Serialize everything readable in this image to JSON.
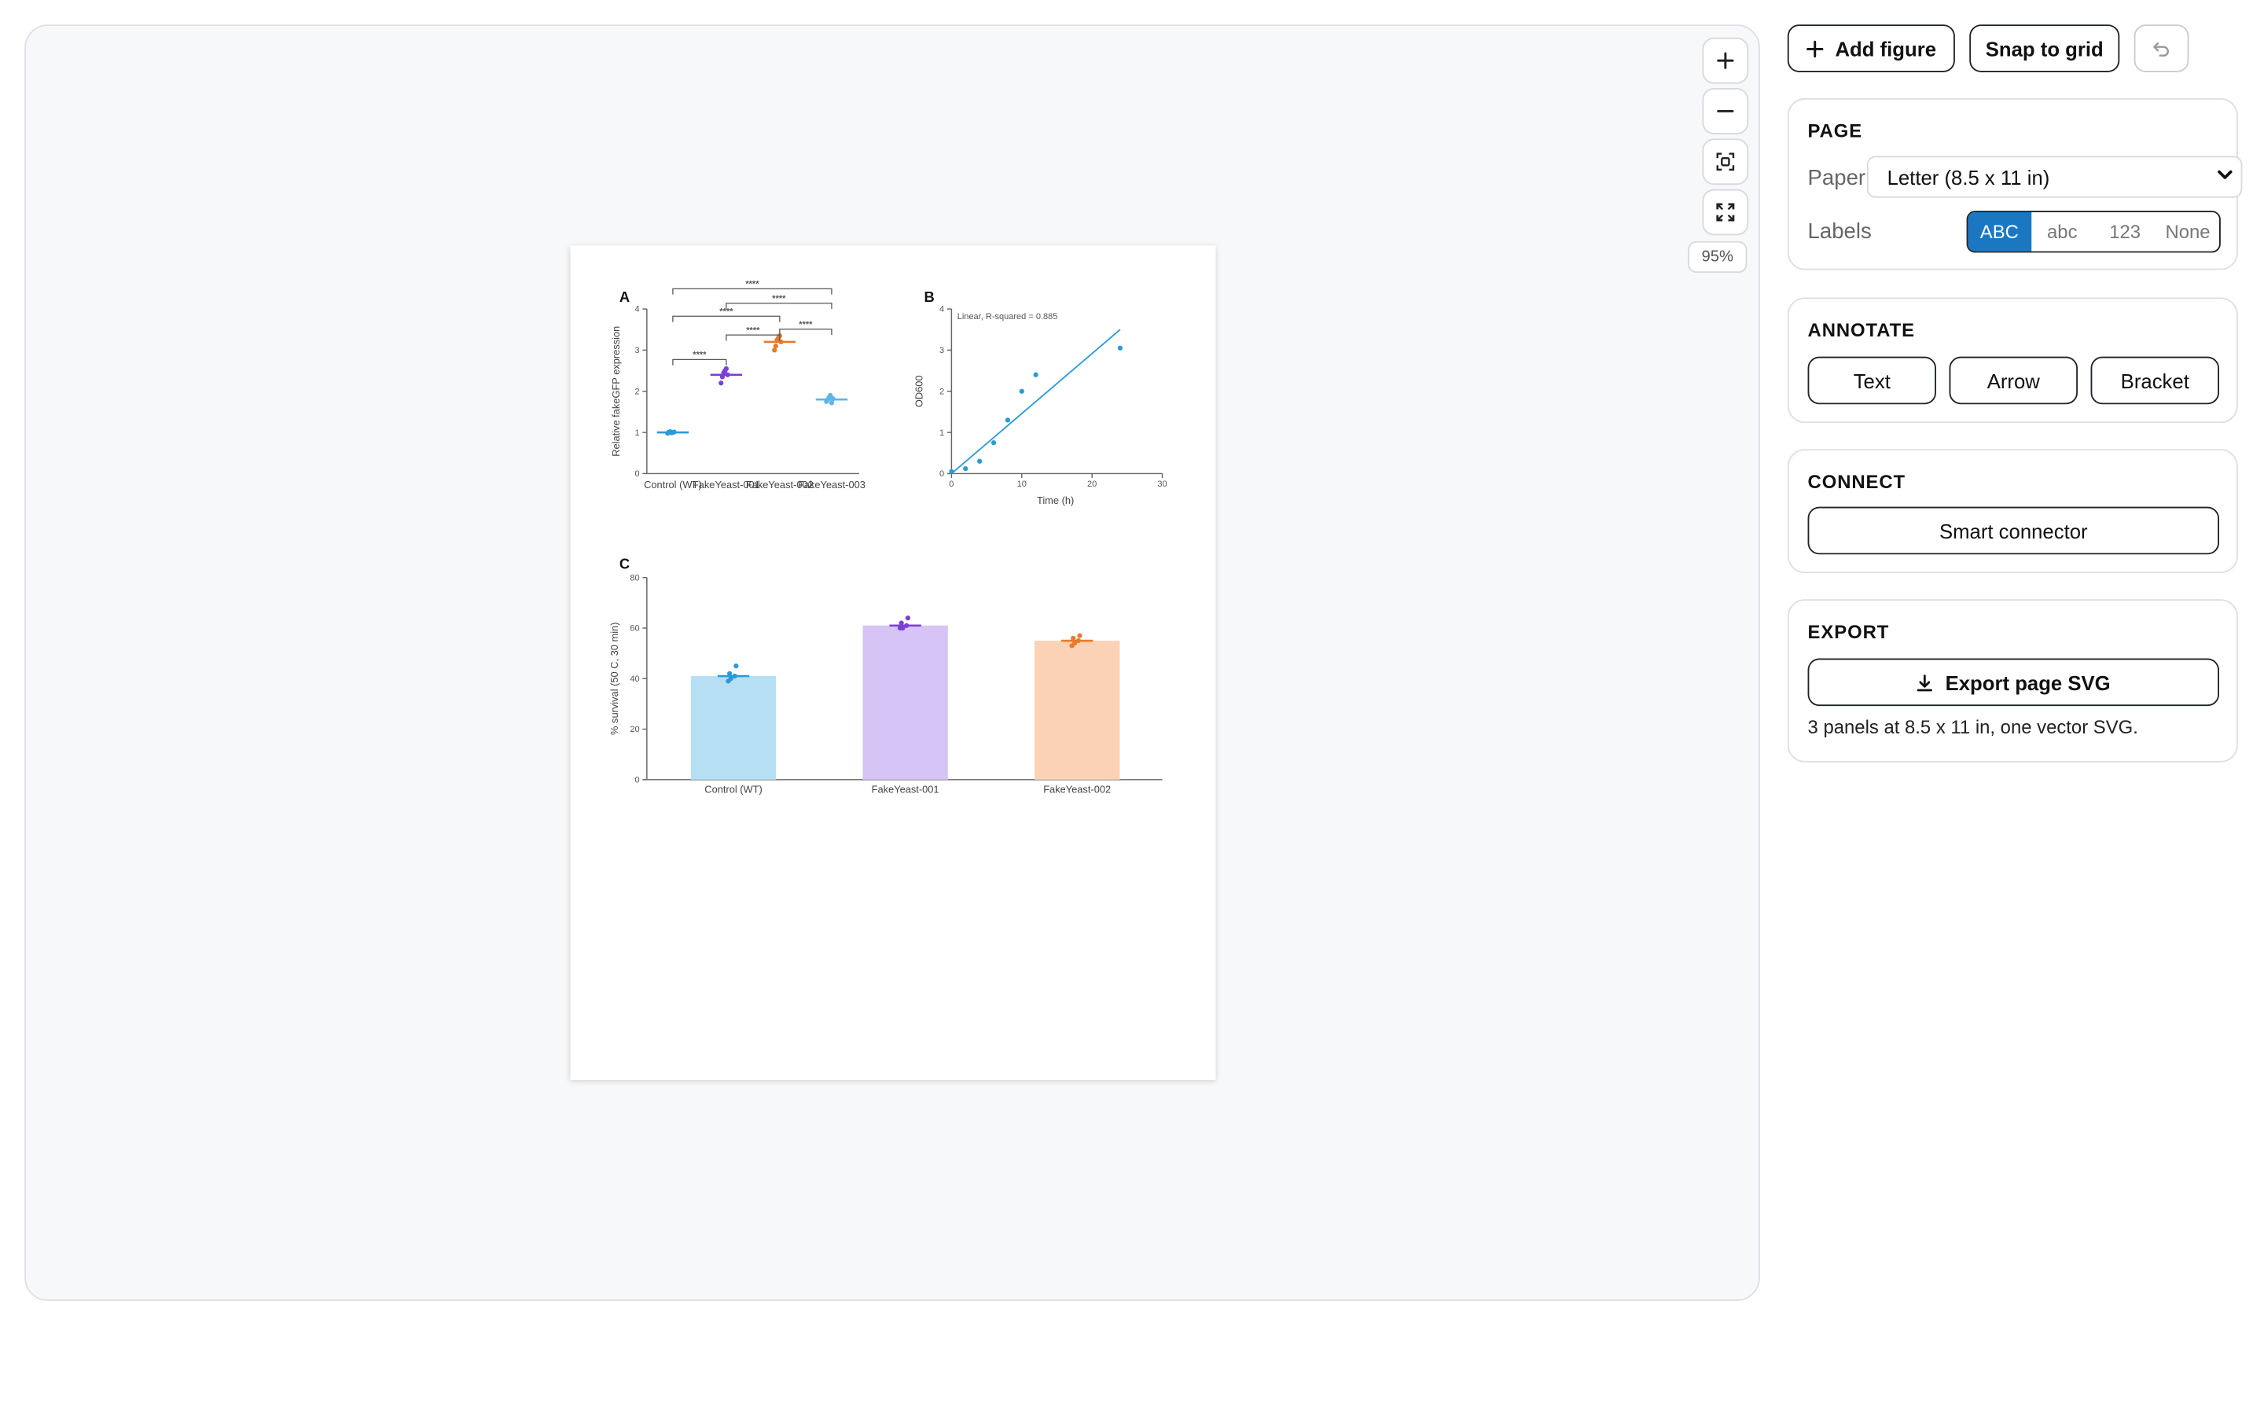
{
  "toolbar": {
    "add_figure": "Add figure",
    "snap_to_grid": "Snap to grid"
  },
  "zoom": {
    "level": "95%"
  },
  "page": {
    "section_title": "PAGE",
    "paper_label": "Paper",
    "paper_value": "Letter (8.5 x 11 in)",
    "labels_label": "Labels",
    "label_options": [
      "ABC",
      "abc",
      "123",
      "None"
    ],
    "label_selected": "ABC"
  },
  "annotate": {
    "section_title": "ANNOTATE",
    "text": "Text",
    "arrow": "Arrow",
    "bracket": "Bracket"
  },
  "connect": {
    "section_title": "CONNECT",
    "smart_connector": "Smart connector"
  },
  "export": {
    "section_title": "EXPORT",
    "button": "Export page SVG",
    "note": "3 panels at 8.5 x 11 in, one vector SVG."
  },
  "colors": {
    "accent": "#1a78c2",
    "blue": "#2a9ad8",
    "purple": "#7b3fd6",
    "orange": "#e87a2a",
    "light_blue": "#5fb4e6"
  },
  "icons": [
    "plus-icon",
    "undo-icon",
    "zoom-in-icon",
    "zoom-out-icon",
    "fit-screen-icon",
    "fullscreen-icon",
    "download-icon",
    "chevron-down-icon"
  ],
  "chart_data": [
    {
      "panel": "A",
      "type": "scatter",
      "categories": [
        "Control (WT)",
        "FakeYeast-001",
        "FakeYeast-002",
        "FakeYeast-003"
      ],
      "ylabel": "Relative fakeGFP expression",
      "ylim": [
        0,
        4
      ],
      "yticks": [
        "0",
        "1",
        "2",
        "3",
        "4"
      ],
      "series": [
        {
          "category": "Control (WT)",
          "mean": 1.0,
          "points": [
            0.98,
            1.01,
            1.02,
            0.99,
            1.0,
            1.01
          ]
        },
        {
          "category": "FakeYeast-001",
          "mean": 2.4,
          "points": [
            2.2,
            2.35,
            2.45,
            2.5,
            2.55,
            2.4
          ]
        },
        {
          "category": "FakeYeast-002",
          "mean": 3.2,
          "points": [
            3.0,
            3.1,
            3.25,
            3.3,
            3.35,
            3.2
          ]
        },
        {
          "category": "FakeYeast-003",
          "mean": 1.8,
          "points": [
            1.75,
            1.8,
            1.85,
            1.9,
            1.72,
            1.82
          ]
        }
      ],
      "significance": [
        {
          "from": "Control (WT)",
          "to": "FakeYeast-001",
          "label": "****"
        },
        {
          "from": "FakeYeast-001",
          "to": "FakeYeast-002",
          "label": "****"
        },
        {
          "from": "FakeYeast-002",
          "to": "FakeYeast-003",
          "label": "****"
        },
        {
          "from": "Control (WT)",
          "to": "FakeYeast-002",
          "label": "****"
        },
        {
          "from": "FakeYeast-001",
          "to": "FakeYeast-003",
          "label": "****"
        },
        {
          "from": "Control (WT)",
          "to": "FakeYeast-003",
          "label": "****"
        }
      ]
    },
    {
      "panel": "B",
      "type": "scatter",
      "annotation": "Linear, R-squared = 0.885",
      "xlabel": "Time (h)",
      "ylabel": "OD600",
      "xlim": [
        0,
        30
      ],
      "ylim": [
        0,
        4
      ],
      "xticks": [
        "0",
        "10",
        "20",
        "30"
      ],
      "yticks": [
        "0",
        "1",
        "2",
        "3",
        "4"
      ],
      "points": [
        [
          0,
          0.05
        ],
        [
          2,
          0.12
        ],
        [
          4,
          0.3
        ],
        [
          6,
          0.75
        ],
        [
          8,
          1.3
        ],
        [
          10,
          2.0
        ],
        [
          12,
          2.4
        ],
        [
          24,
          3.05
        ]
      ],
      "fit_line": [
        [
          0,
          0.0
        ],
        [
          24,
          3.5
        ]
      ]
    },
    {
      "panel": "C",
      "type": "bar",
      "categories": [
        "Control (WT)",
        "FakeYeast-001",
        "FakeYeast-002"
      ],
      "values": [
        41,
        61,
        55
      ],
      "ylabel": "% survival (50 C, 30 min)",
      "ylim": [
        0,
        80
      ],
      "yticks": [
        "0",
        "20",
        "40",
        "60",
        "80"
      ],
      "points": [
        [
          39,
          41,
          42,
          45,
          40
        ],
        [
          60,
          61,
          62,
          64,
          60
        ],
        [
          53,
          55,
          56,
          57,
          54
        ]
      ]
    }
  ]
}
